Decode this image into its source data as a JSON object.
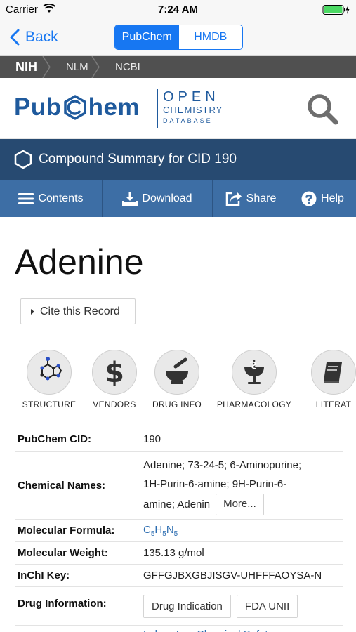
{
  "status_bar": {
    "carrier": "Carrier",
    "time": "7:24 AM"
  },
  "nav": {
    "back_label": "Back",
    "segments": [
      {
        "label": "PubChem",
        "selected": true
      },
      {
        "label": "HMDB",
        "selected": false
      }
    ]
  },
  "breadcrumb": {
    "items": [
      "NIH",
      "NLM",
      "NCBI"
    ]
  },
  "header": {
    "logo_left": "Pub",
    "logo_right": "hem",
    "tagline": {
      "line1": "OPEN",
      "line2": "CHEMISTRY",
      "line3": "DATABASE"
    }
  },
  "summary": {
    "title": "Compound Summary for CID 190"
  },
  "toolbar": {
    "contents": "Contents",
    "download": "Download",
    "share": "Share",
    "help": "Help"
  },
  "compound": {
    "name": "Adenine",
    "cite_label": "Cite this Record"
  },
  "icon_nav": [
    "STRUCTURE",
    "VENDORS",
    "DRUG INFO",
    "PHARMACOLOGY",
    "LITERAT"
  ],
  "table": {
    "cid": {
      "label": "PubChem CID:",
      "value": "190"
    },
    "names": {
      "label": "Chemical Names:",
      "line1": "Adenine; 73-24-5; 6-Aminopurine;",
      "line2": "1H-Purin-6-amine; 9H-Purin-6-",
      "line3": "amine; Adenin",
      "more": "More..."
    },
    "formula": {
      "label": "Molecular Formula:",
      "c": "C",
      "c_n": "5",
      "h": "H",
      "h_n": "5",
      "n": "N",
      "n_n": "5"
    },
    "weight": {
      "label": "Molecular Weight:",
      "value": "135.13 g/mol"
    },
    "inchi": {
      "label": "InChI Key:",
      "value": "GFFGJBXGBJISGV-UHFFFAOYSA-N"
    },
    "drug": {
      "label": "Drug Information:",
      "chip1": "Drug Indication",
      "chip2": "FDA UNII"
    },
    "safety_partial": "Laboratory Chemical Safety"
  },
  "colors": {
    "ios_blue": "#1777f2",
    "pubchem_blue": "#1f5a9d",
    "summary_bar": "#274a71",
    "toolbar": "#3d6ea5"
  }
}
